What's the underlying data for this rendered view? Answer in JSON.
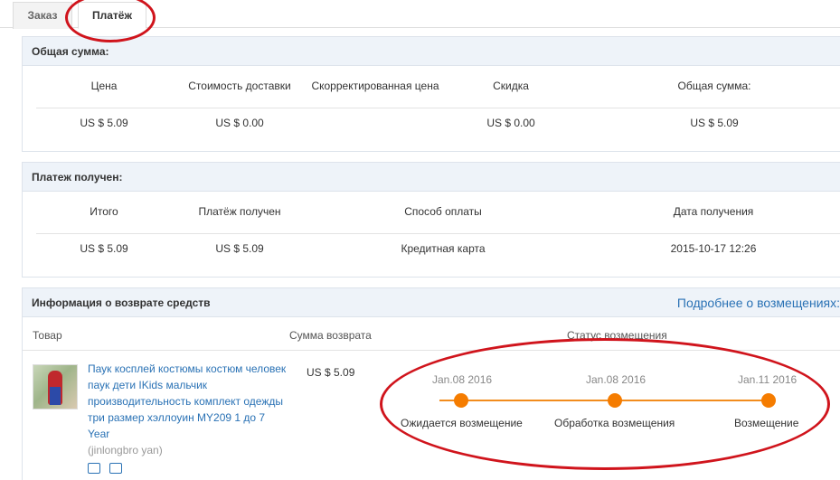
{
  "tabs": [
    {
      "label": "Заказ"
    },
    {
      "label": "Платёж"
    }
  ],
  "total_panel": {
    "title": "Общая сумма:",
    "headers": [
      "Цена",
      "Стоимость доставки",
      "Скорректированная цена",
      "Скидка",
      "Общая сумма:"
    ],
    "values": [
      "US $ 5.09",
      "US $ 0.00",
      "",
      "US $ 0.00",
      "US $ 5.09"
    ]
  },
  "payment_panel": {
    "title": "Платеж получен:",
    "headers": [
      "Итого",
      "Платёж получен",
      "Способ оплаты",
      "Дата получения"
    ],
    "values": [
      "US $ 5.09",
      "US $ 5.09",
      "Кредитная карта",
      "2015-10-17 12:26"
    ]
  },
  "refund_panel": {
    "title": "Информация о возврате средств",
    "more_link": "Подробнее о возмещениях:",
    "headers": {
      "product": "Товар",
      "amount": "Сумма возврата",
      "status": "Статус возмещения"
    },
    "product": {
      "title": "Паук косплей костюмы костюм человек паук дети IKids мальчик производительность комплект одежды три размер хэллоуин MY209 1 до 7 Year",
      "seller": "(jinlongbro yan)",
      "icons": [
        "shipping-icon",
        "refund-return-icon"
      ]
    },
    "amount": "US $ 5.09",
    "timeline": [
      {
        "date": "Jan.08 2016",
        "label": "Ожидается возмещение"
      },
      {
        "date": "Jan.08 2016",
        "label": "Обработка возмещения"
      },
      {
        "date": "Jan.11 2016",
        "label": "Возмещение"
      }
    ],
    "accent_color": "#f57c00"
  },
  "annotation_color": "#d0141c"
}
